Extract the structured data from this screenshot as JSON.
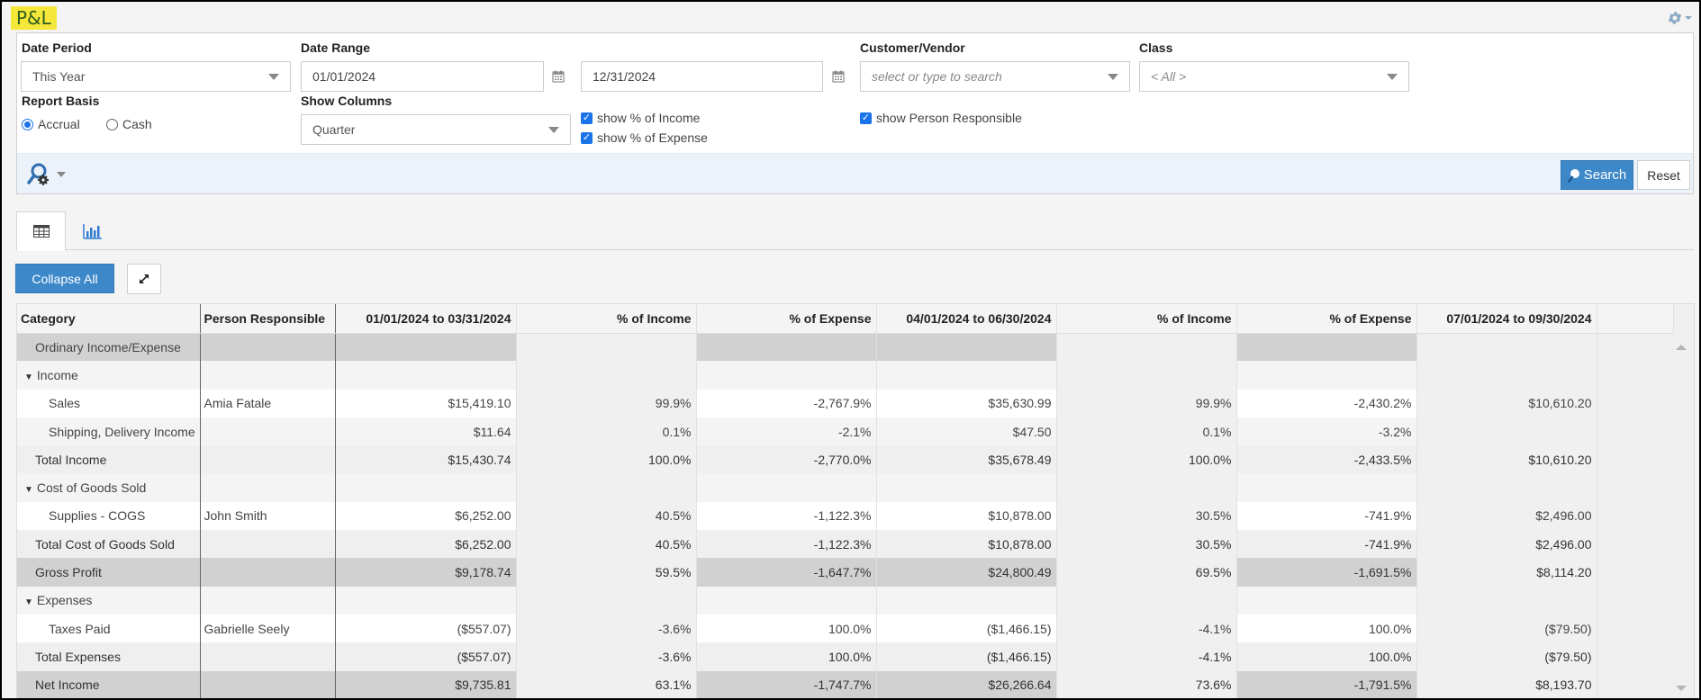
{
  "page": {
    "title": "P&L"
  },
  "filters": {
    "date_period": {
      "label": "Date Period",
      "value": "This Year"
    },
    "date_range": {
      "label": "Date Range",
      "from": "01/01/2024",
      "to": "12/31/2024"
    },
    "customer_vendor": {
      "label": "Customer/Vendor",
      "placeholder": "select or type to search"
    },
    "class": {
      "label": "Class",
      "value": "< All >"
    },
    "report_basis": {
      "label": "Report Basis",
      "options": [
        {
          "label": "Accrual",
          "selected": true
        },
        {
          "label": "Cash",
          "selected": false
        }
      ]
    },
    "show_columns": {
      "label": "Show Columns",
      "value": "Quarter"
    },
    "checkboxes": {
      "pct_income": {
        "label": "show % of Income",
        "checked": true
      },
      "pct_expense": {
        "label": "show % of Expense",
        "checked": true
      },
      "person_responsible": {
        "label": "show Person Responsible",
        "checked": true
      }
    }
  },
  "toolbar": {
    "search_label": "Search",
    "reset_label": "Reset"
  },
  "view_tabs": [
    {
      "name": "table-view",
      "icon": "table-icon",
      "active": true
    },
    {
      "name": "chart-view",
      "icon": "bar-chart-icon",
      "active": false
    }
  ],
  "actions": {
    "collapse_all_label": "Collapse All",
    "expand_icon": "expand-arrows-icon"
  },
  "table": {
    "columns": [
      "Category",
      "Person Responsible",
      "01/01/2024 to 03/31/2024",
      "% of Income",
      "% of Expense",
      "04/01/2024 to 06/30/2024",
      "% of Income",
      "% of Expense",
      "07/01/2024 to 09/30/2024"
    ],
    "rows": [
      {
        "type": "section",
        "category": "Ordinary Income/Expense",
        "person": "",
        "values": [
          "",
          "",
          "",
          "",
          "",
          "",
          ""
        ]
      },
      {
        "type": "group",
        "category": "Income",
        "person": "",
        "values": [
          "",
          "",
          "",
          "",
          "",
          "",
          ""
        ]
      },
      {
        "type": "detail",
        "category": "Sales",
        "person": "Amia Fatale",
        "values": [
          "$15,419.10",
          "99.9%",
          "-2,767.9%",
          "$35,630.99",
          "99.9%",
          "-2,430.2%",
          "$10,610.20"
        ]
      },
      {
        "type": "detail2",
        "category": "Shipping, Delivery Income",
        "person": "",
        "values": [
          "$11.64",
          "0.1%",
          "-2.1%",
          "$47.50",
          "0.1%",
          "-3.2%",
          ""
        ]
      },
      {
        "type": "total",
        "category": "Total Income",
        "person": "",
        "values": [
          "$15,430.74",
          "100.0%",
          "-2,770.0%",
          "$35,678.49",
          "100.0%",
          "-2,433.5%",
          "$10,610.20"
        ]
      },
      {
        "type": "group",
        "category": "Cost of Goods Sold",
        "person": "",
        "values": [
          "",
          "",
          "",
          "",
          "",
          "",
          ""
        ]
      },
      {
        "type": "detail",
        "category": "Supplies - COGS",
        "person": "John Smith",
        "values": [
          "$6,252.00",
          "40.5%",
          "-1,122.3%",
          "$10,878.00",
          "30.5%",
          "-741.9%",
          "$2,496.00"
        ]
      },
      {
        "type": "total",
        "category": "Total Cost of Goods Sold",
        "person": "",
        "values": [
          "$6,252.00",
          "40.5%",
          "-1,122.3%",
          "$10,878.00",
          "30.5%",
          "-741.9%",
          "$2,496.00"
        ]
      },
      {
        "type": "grand",
        "category": "Gross Profit",
        "person": "",
        "values": [
          "$9,178.74",
          "59.5%",
          "-1,647.7%",
          "$24,800.49",
          "69.5%",
          "-1,691.5%",
          "$8,114.20"
        ]
      },
      {
        "type": "group",
        "category": "Expenses",
        "person": "",
        "values": [
          "",
          "",
          "",
          "",
          "",
          "",
          ""
        ]
      },
      {
        "type": "detail",
        "category": "Taxes Paid",
        "person": "Gabrielle Seely",
        "values": [
          "($557.07)",
          "-3.6%",
          "100.0%",
          "($1,466.15)",
          "-4.1%",
          "100.0%",
          "($79.50)"
        ]
      },
      {
        "type": "total",
        "category": "Total Expenses",
        "person": "",
        "values": [
          "($557.07)",
          "-3.6%",
          "100.0%",
          "($1,466.15)",
          "-4.1%",
          "100.0%",
          "($79.50)"
        ]
      },
      {
        "type": "grand",
        "category": "Net Income",
        "person": "",
        "values": [
          "$9,735.81",
          "63.1%",
          "-1,747.7%",
          "$26,266.64",
          "73.6%",
          "-1,791.5%",
          "$8,193.70"
        ]
      }
    ]
  }
}
